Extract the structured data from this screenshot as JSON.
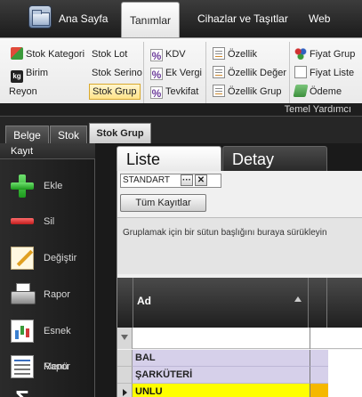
{
  "top_tabs": [
    "Ana Sayfa",
    "Tanımlar",
    "Cihazlar ve Taşıtlar",
    "Web"
  ],
  "ribbon": {
    "caption": "Temel Yardımcı",
    "col1": [
      "Stok Kategori",
      "Birim",
      "Reyon"
    ],
    "col2": [
      "Stok Lot",
      "Stok Serino",
      "Stok Grup"
    ],
    "col3": [
      "KDV",
      "Ek Vergi",
      "Tevkifat"
    ],
    "col4": [
      "Özellik",
      "Özellik Değer",
      "Özellik Grup"
    ],
    "col5": [
      "Fiyat Grup",
      "Fiyat Liste",
      "Ödeme"
    ],
    "selected": "Stok Grup"
  },
  "doc_tabs": [
    "Belge",
    "Stok",
    "Stok Grup"
  ],
  "left_panel": {
    "title": "Kayıt",
    "buttons": [
      {
        "label": "Ekle",
        "icon": "plus-icon"
      },
      {
        "label": "Sil",
        "icon": "minus-icon"
      },
      {
        "label": "Değiştir",
        "icon": "edit-icon"
      },
      {
        "label": "Rapor",
        "icon": "printer-icon"
      },
      {
        "label": "Esnek Rapor",
        "icon": "report-icon"
      },
      {
        "label": "Menü",
        "icon": "menu-icon"
      }
    ]
  },
  "main": {
    "tabs": [
      "Liste",
      "Detay"
    ],
    "layout_name": "STANDART",
    "all_records_button": "Tüm Kayıtlar",
    "group_hint": "Gruplamak için bir sütun başlığını buraya sürükleyin",
    "column_header": "Ad",
    "rows": [
      "BAL",
      "ŞARKÜTERİ",
      "UNLU"
    ],
    "selected_row": "UNLU"
  },
  "colors": {
    "row_background": "#d6d0ea",
    "selected_row": "#ffff00",
    "selected_accent": "#f5b800"
  }
}
